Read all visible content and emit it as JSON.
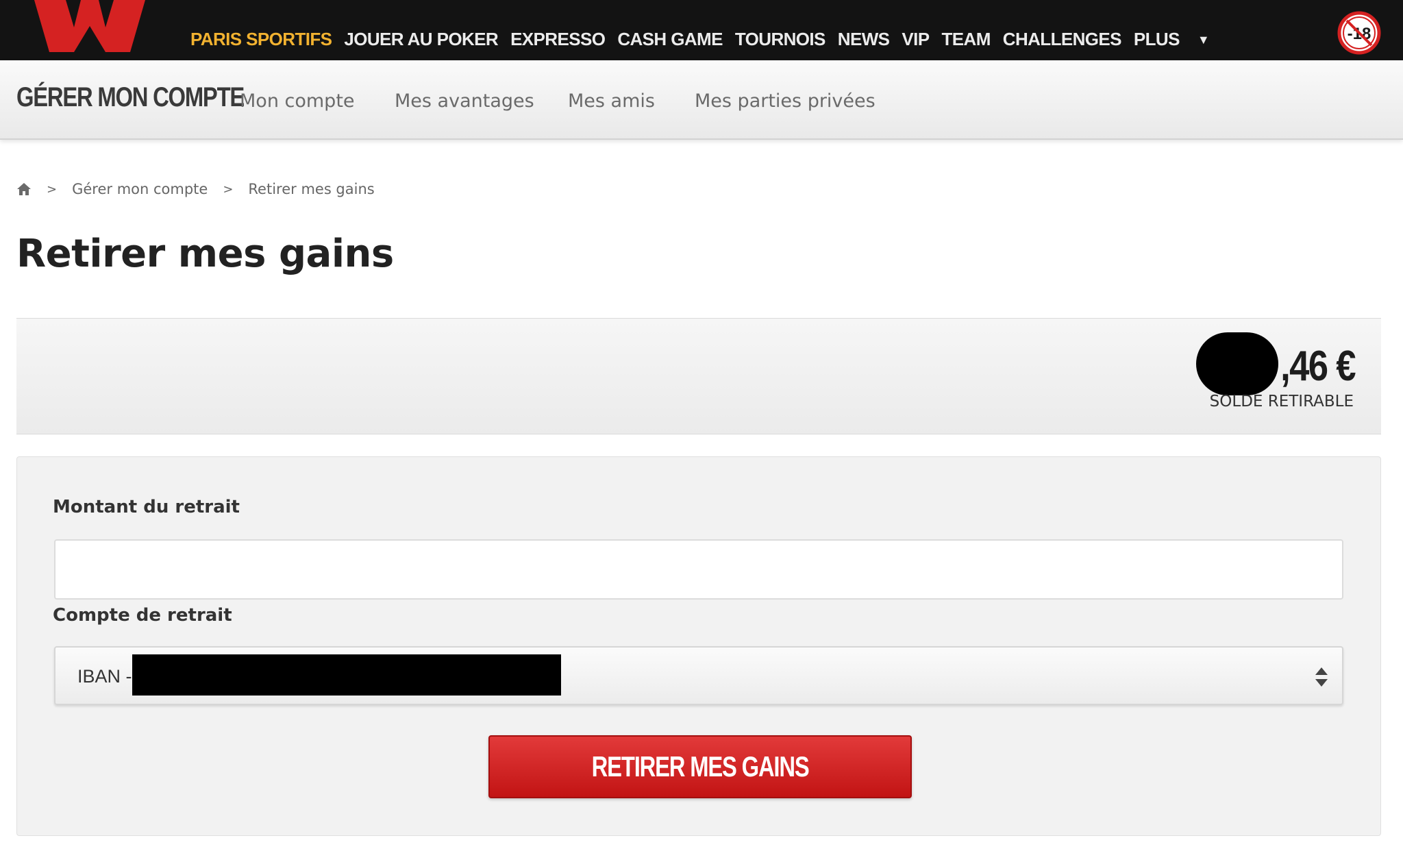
{
  "colors": {
    "top_bar_bg": "#131313",
    "brand_red": "#d52222",
    "active_nav": "#f2b230",
    "button_red": "#c21414"
  },
  "top_nav": {
    "items": [
      {
        "label": "PARIS SPORTIFS",
        "active": true
      },
      {
        "label": "JOUER AU POKER",
        "active": false
      },
      {
        "label": "EXPRESSO",
        "active": false
      },
      {
        "label": "CASH GAME",
        "active": false
      },
      {
        "label": "TOURNOIS",
        "active": false
      },
      {
        "label": "NEWS",
        "active": false
      },
      {
        "label": "VIP",
        "active": false
      },
      {
        "label": "TEAM",
        "active": false
      },
      {
        "label": "CHALLENGES",
        "active": false
      }
    ],
    "more_label": "PLUS",
    "age_badge": "-18"
  },
  "sub_nav": {
    "title": "GÉRER MON COMPTE",
    "links": [
      "Mon compte",
      "Mes avantages",
      "Mes amis",
      "Mes parties privées"
    ]
  },
  "breadcrumb": {
    "home_icon": "home-icon",
    "separator": ">",
    "items": [
      "Gérer mon compte",
      "Retirer mes gains"
    ]
  },
  "page_title": "Retirer mes gains",
  "balance": {
    "amount_visible": ",46 €",
    "label": "SOLDE RETIRABLE"
  },
  "form": {
    "amount_label": "Montant du retrait",
    "amount_value": "",
    "account_label": "Compte de retrait",
    "account_selected": "IBAN -",
    "submit_label": "RETIRER MES GAINS"
  }
}
